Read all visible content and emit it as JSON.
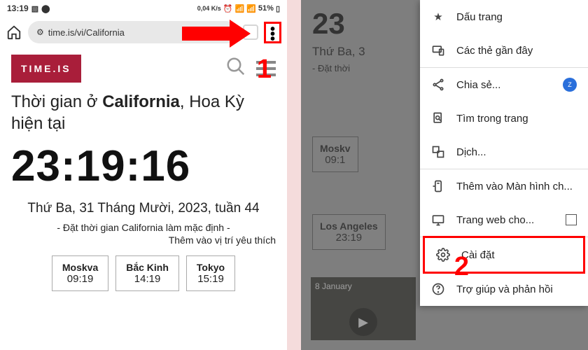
{
  "status": {
    "time": "13:19",
    "speed": "0,04\nK/s",
    "battery": "51%"
  },
  "browser": {
    "url": "time.is/vi/California"
  },
  "page": {
    "logo": "TIME.IS",
    "title_prefix": "Thời gian ở ",
    "title_bold": "California",
    "title_suffix": ", Hoa Kỳ hiện tại",
    "big_time": "23:19:16",
    "date_line": "Thứ Ba, 31 Tháng Mười, 2023, tuần 44",
    "set_default": "- Đặt thời gian California làm mặc định -",
    "add_fav": "Thêm vào vị trí yêu thích",
    "cities": [
      {
        "name": "Moskva",
        "time": "09:19"
      },
      {
        "name": "Bắc Kinh",
        "time": "14:19"
      },
      {
        "name": "Tokyo",
        "time": "15:19"
      }
    ]
  },
  "right": {
    "time_frag": "23",
    "date_frag": "Thứ Ba, 3",
    "set_default_frag": "- Đặt thời",
    "cities": [
      {
        "name": "Moskv",
        "time": "09:1"
      },
      {
        "name": "Los Angeles",
        "time": "23:19"
      }
    ],
    "media_date": "8 January"
  },
  "menu": {
    "bookmark": "Dấu trang",
    "recent_tabs": "Các thẻ gần đây",
    "share": "Chia sẻ...",
    "find": "Tìm trong trang",
    "translate": "Dịch...",
    "add_home": "Thêm vào Màn hình ch...",
    "desktop_site": "Trang web cho...",
    "settings": "Cài đặt",
    "help": "Trợ giúp và phản hồi"
  },
  "steps": {
    "one": "1",
    "two": "2"
  }
}
